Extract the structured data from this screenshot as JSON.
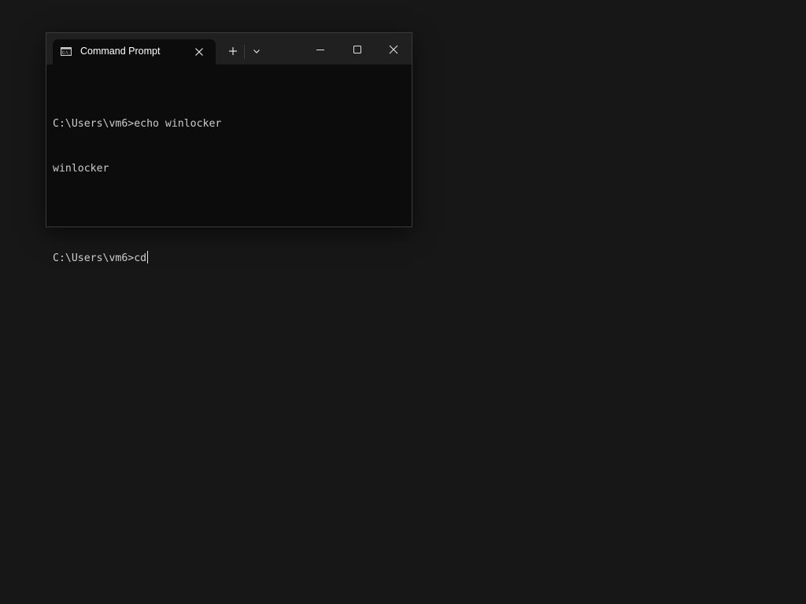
{
  "window": {
    "tab_title": "Command Prompt",
    "tab_icon": "cmd-icon",
    "tab_icon_text": "C:\\_"
  },
  "titlebar": {
    "new_tab_icon": "plus-icon",
    "dropdown_icon": "chevron-down-icon",
    "minimize_icon": "minimize-icon",
    "maximize_icon": "maximize-icon",
    "close_icon": "close-icon"
  },
  "terminal": {
    "lines": [
      "C:\\Users\\vm6>echo winlocker",
      "winlocker",
      "",
      "C:\\Users\\vm6>cd"
    ]
  },
  "colors": {
    "desktop_bg": "#171717",
    "titlebar_bg": "#202020",
    "terminal_bg": "#0c0c0c",
    "terminal_text": "#cccccc"
  }
}
